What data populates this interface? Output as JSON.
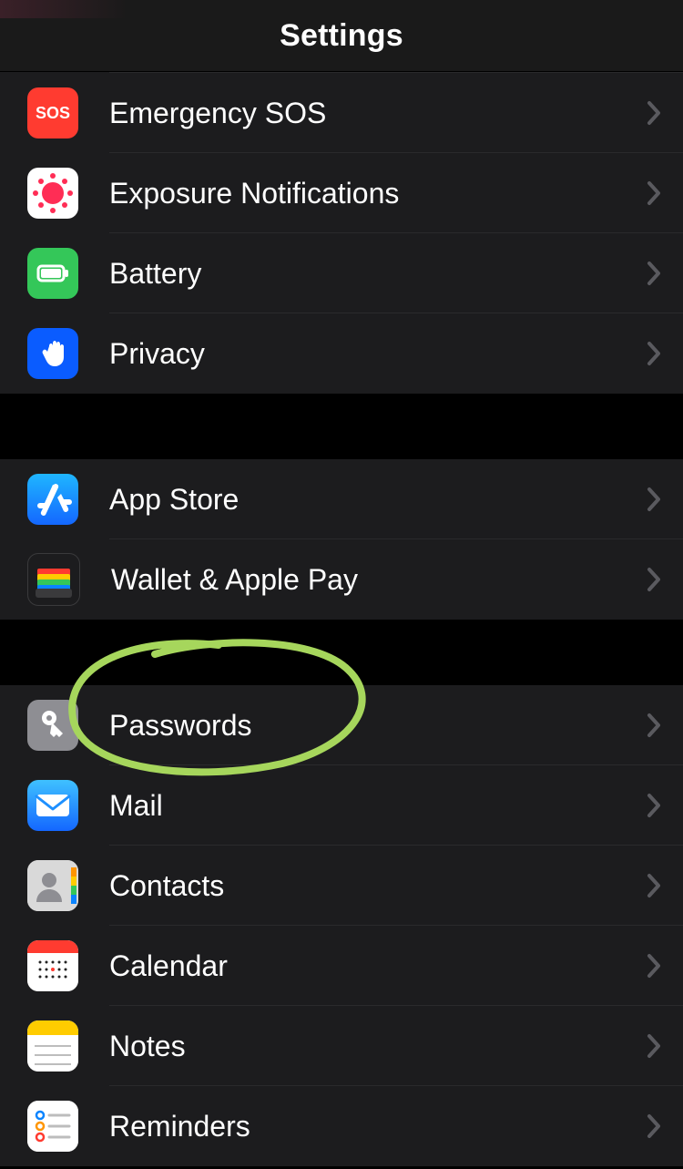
{
  "header": {
    "title": "Settings"
  },
  "groups": [
    {
      "items": [
        {
          "key": "sos",
          "label": "Emergency SOS",
          "icon": "sos-icon"
        },
        {
          "key": "exposure",
          "label": "Exposure Notifications",
          "icon": "exposure-icon"
        },
        {
          "key": "battery",
          "label": "Battery",
          "icon": "battery-icon"
        },
        {
          "key": "privacy",
          "label": "Privacy",
          "icon": "privacy-icon"
        }
      ]
    },
    {
      "items": [
        {
          "key": "appstore",
          "label": "App Store",
          "icon": "appstore-icon"
        },
        {
          "key": "wallet",
          "label": "Wallet & Apple Pay",
          "icon": "wallet-icon"
        }
      ]
    },
    {
      "items": [
        {
          "key": "passwords",
          "label": "Passwords",
          "icon": "passwords-icon",
          "annotated": true
        },
        {
          "key": "mail",
          "label": "Mail",
          "icon": "mail-icon"
        },
        {
          "key": "contacts",
          "label": "Contacts",
          "icon": "contacts-icon"
        },
        {
          "key": "calendar",
          "label": "Calendar",
          "icon": "calendar-icon"
        },
        {
          "key": "notes",
          "label": "Notes",
          "icon": "notes-icon"
        },
        {
          "key": "reminders",
          "label": "Reminders",
          "icon": "reminders-icon"
        }
      ]
    }
  ]
}
